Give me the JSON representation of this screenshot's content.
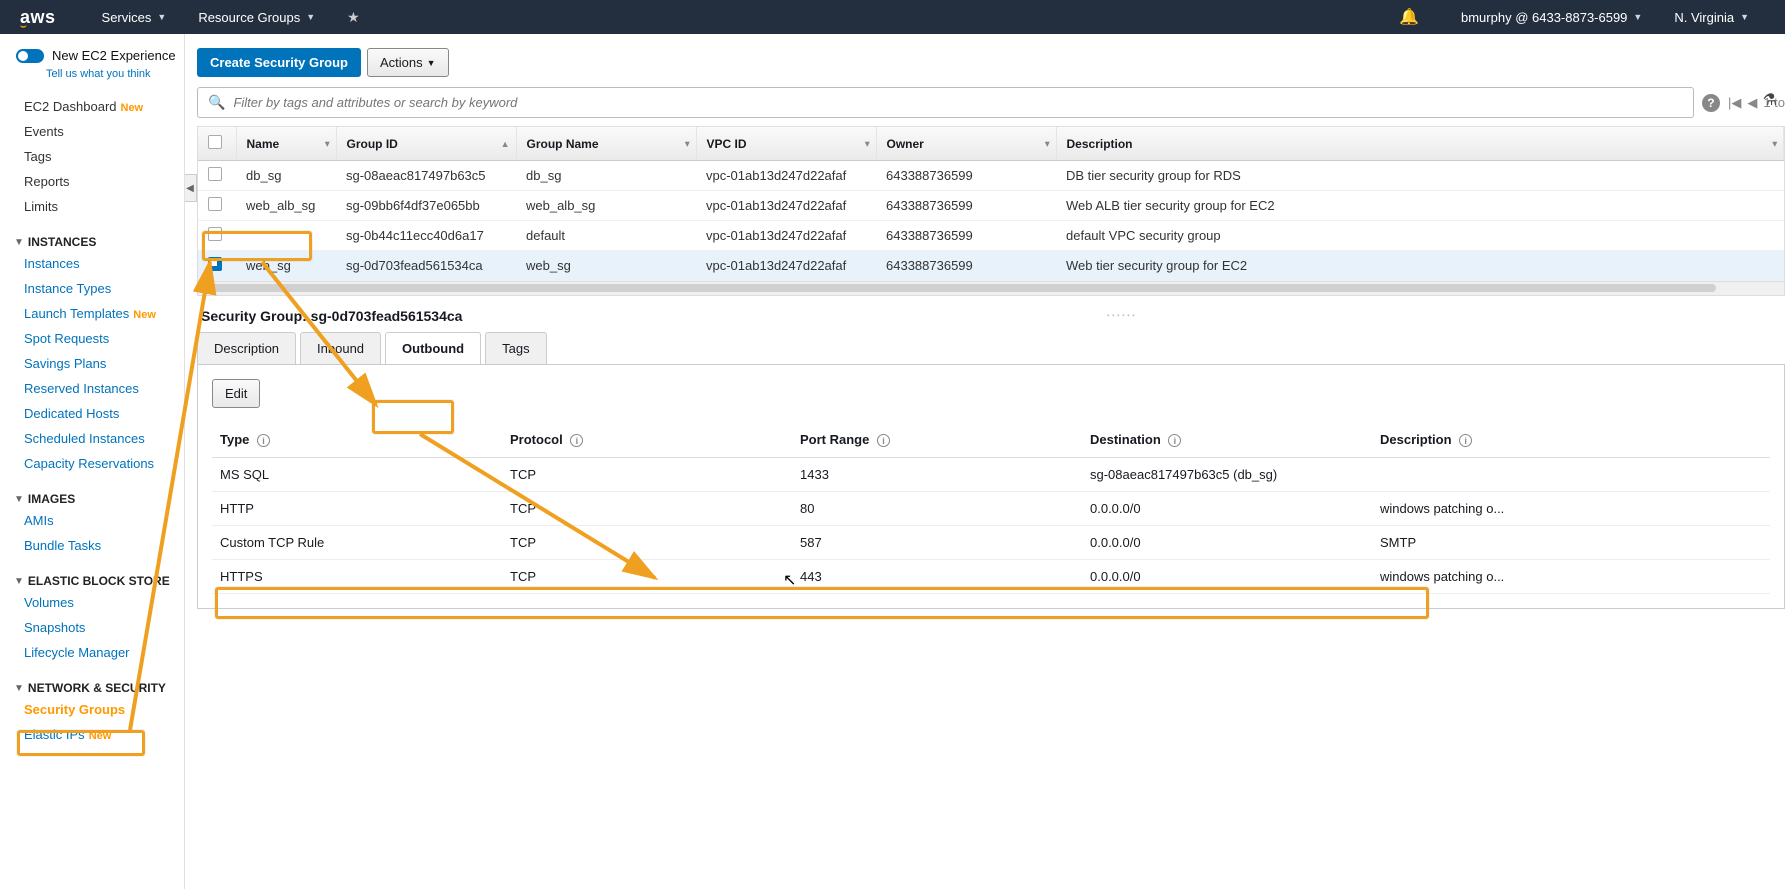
{
  "topnav": {
    "services": "Services",
    "resource_groups": "Resource Groups",
    "user": "bmurphy @ 6433-8873-6599",
    "region": "N. Virginia"
  },
  "sidebar": {
    "new_exp": "New EC2 Experience",
    "new_exp_sub": "Tell us what you think",
    "links_top": [
      {
        "label": "EC2 Dashboard",
        "new": true,
        "plain": true
      },
      {
        "label": "Events",
        "plain": true
      },
      {
        "label": "Tags",
        "plain": true
      },
      {
        "label": "Reports",
        "plain": true
      },
      {
        "label": "Limits",
        "plain": true
      }
    ],
    "sec_instances": "INSTANCES",
    "links_instances": [
      {
        "label": "Instances"
      },
      {
        "label": "Instance Types"
      },
      {
        "label": "Launch Templates",
        "new": true
      },
      {
        "label": "Spot Requests"
      },
      {
        "label": "Savings Plans"
      },
      {
        "label": "Reserved Instances"
      },
      {
        "label": "Dedicated Hosts"
      },
      {
        "label": "Scheduled Instances"
      },
      {
        "label": "Capacity Reservations"
      }
    ],
    "sec_images": "IMAGES",
    "links_images": [
      {
        "label": "AMIs"
      },
      {
        "label": "Bundle Tasks"
      }
    ],
    "sec_ebs": "ELASTIC BLOCK STORE",
    "links_ebs": [
      {
        "label": "Volumes"
      },
      {
        "label": "Snapshots"
      },
      {
        "label": "Lifecycle Manager"
      }
    ],
    "sec_network": "NETWORK & SECURITY",
    "links_network": [
      {
        "label": "Security Groups",
        "active": true
      },
      {
        "label": "Elastic IPs",
        "new": true
      }
    ]
  },
  "toolbar": {
    "create": "Create Security Group",
    "actions": "Actions"
  },
  "search": {
    "placeholder": "Filter by tags and attributes or search by keyword"
  },
  "pager": {
    "text": "1 to"
  },
  "table": {
    "headers": [
      "Name",
      "Group ID",
      "Group Name",
      "VPC ID",
      "Owner",
      "Description"
    ],
    "rows": [
      {
        "sel": false,
        "name": "db_sg",
        "gid": "sg-08aeac817497b63c5",
        "gname": "db_sg",
        "vpc": "vpc-01ab13d247d22afaf",
        "owner": "643388736599",
        "desc": "DB tier security group for RDS"
      },
      {
        "sel": false,
        "name": "web_alb_sg",
        "gid": "sg-09bb6f4df37e065bb",
        "gname": "web_alb_sg",
        "vpc": "vpc-01ab13d247d22afaf",
        "owner": "643388736599",
        "desc": "Web ALB tier security group for EC2"
      },
      {
        "sel": false,
        "name": "",
        "gid": "sg-0b44c11ecc40d6a17",
        "gname": "default",
        "vpc": "vpc-01ab13d247d22afaf",
        "owner": "643388736599",
        "desc": "default VPC security group"
      },
      {
        "sel": true,
        "name": "web_sg",
        "gid": "sg-0d703fead561534ca",
        "gname": "web_sg",
        "vpc": "vpc-01ab13d247d22afaf",
        "owner": "643388736599",
        "desc": "Web tier security group for EC2"
      }
    ]
  },
  "detail": {
    "title": "Security Group: sg-0d703fead561534ca",
    "tabs": [
      "Description",
      "Inbound",
      "Outbound",
      "Tags"
    ],
    "active_tab": 2,
    "edit": "Edit",
    "rule_headers": [
      "Type",
      "Protocol",
      "Port Range",
      "Destination",
      "Description"
    ],
    "rules": [
      {
        "type": "MS SQL",
        "proto": "TCP",
        "port": "1433",
        "dest": "sg-08aeac817497b63c5 (db_sg)",
        "desc": ""
      },
      {
        "type": "HTTP",
        "proto": "TCP",
        "port": "80",
        "dest": "0.0.0.0/0",
        "desc": "windows patching o..."
      },
      {
        "type": "Custom TCP Rule",
        "proto": "TCP",
        "port": "587",
        "dest": "0.0.0.0/0",
        "desc": "SMTP"
      },
      {
        "type": "HTTPS",
        "proto": "TCP",
        "port": "443",
        "dest": "0.0.0.0/0",
        "desc": "windows patching o..."
      }
    ]
  }
}
